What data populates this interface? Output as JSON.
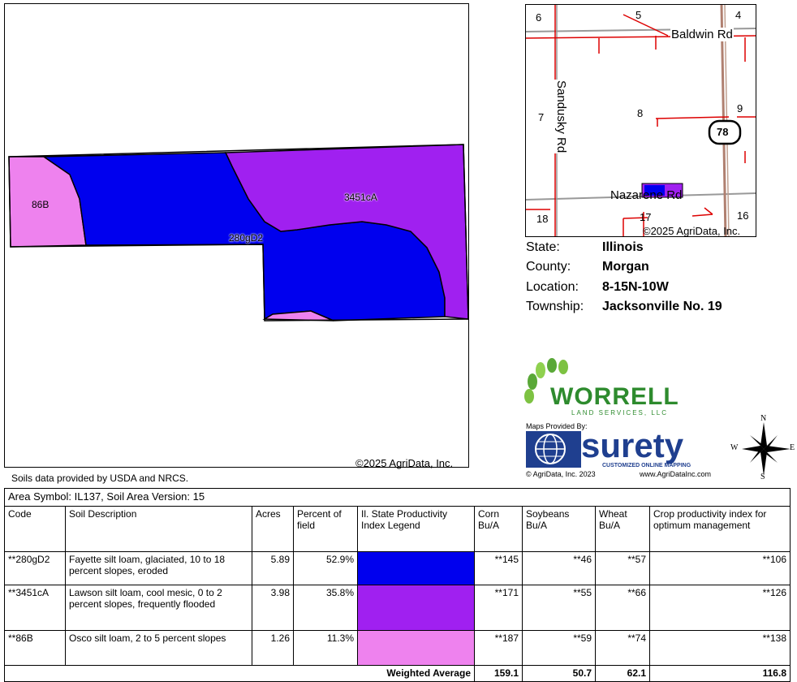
{
  "soil_map": {
    "labels": [
      "86B",
      "3451cA",
      "280gD2"
    ],
    "copyright": "©2025 AgriData, Inc."
  },
  "location_map": {
    "roads": [
      "Baldwin Rd",
      "Sandusky Rd",
      "Nazarene Rd"
    ],
    "route_marker": "78",
    "section_numbers": [
      "6",
      "5",
      "4",
      "7",
      "8",
      "9",
      "18",
      "17",
      "16"
    ],
    "copyright": "©2025 AgriData, Inc."
  },
  "location_info": [
    {
      "key": "State:",
      "value": "Illinois"
    },
    {
      "key": "County:",
      "value": "Morgan"
    },
    {
      "key": "Location:",
      "value": "8-15N-10W"
    },
    {
      "key": "Township:",
      "value": "Jacksonville No. 19"
    }
  ],
  "branding": {
    "worrell_name": "WORRELL",
    "worrell_sub": "LAND SERVICES, LLC",
    "maps_provided_by": "Maps Provided By:",
    "surety_name": "surety",
    "surety_tagline": "CUSTOMIZED ONLINE MAPPING",
    "surety_copyright": "© AgriData, Inc. 2023",
    "surety_url": "www.AgriDataInc.com"
  },
  "compass": {
    "n": "N",
    "s": "S",
    "e": "E",
    "w": "W"
  },
  "source_note": "Soils data provided by USDA and NRCS.",
  "table": {
    "area_line": "Area Symbol: IL137, Soil Area Version: 15",
    "headers": {
      "code": "Code",
      "desc": "Soil Description",
      "acres": "Acres",
      "pct": "Percent of field",
      "legend": "Il. State Productivity Index Legend",
      "corn": "Corn Bu/A",
      "soy": "Soybeans Bu/A",
      "wheat": "Wheat Bu/A",
      "cpi": "Crop productivity index for optimum management"
    },
    "rows": [
      {
        "code": "**280gD2",
        "desc": "Fayette silt loam, glaciated, 10 to 18 percent slopes, eroded",
        "acres": "5.89",
        "pct": "52.9%",
        "color": "#0000ee",
        "corn": "**145",
        "soy": "**46",
        "wheat": "**57",
        "cpi": "**106"
      },
      {
        "code": "**3451cA",
        "desc": "Lawson silt loam, cool mesic, 0 to 2 percent slopes, frequently flooded",
        "acres": "3.98",
        "pct": "35.8%",
        "color": "#a020f0",
        "corn": "**171",
        "soy": "**55",
        "wheat": "**66",
        "cpi": "**126"
      },
      {
        "code": "**86B",
        "desc": "Osco silt loam, 2 to 5 percent slopes",
        "acres": "1.26",
        "pct": "11.3%",
        "color": "#ee82ee",
        "corn": "**187",
        "soy": "**59",
        "wheat": "**74",
        "cpi": "**138"
      }
    ],
    "weighted": {
      "label": "Weighted Average",
      "corn": "159.1",
      "soy": "50.7",
      "wheat": "62.1",
      "cpi": "116.8"
    }
  }
}
